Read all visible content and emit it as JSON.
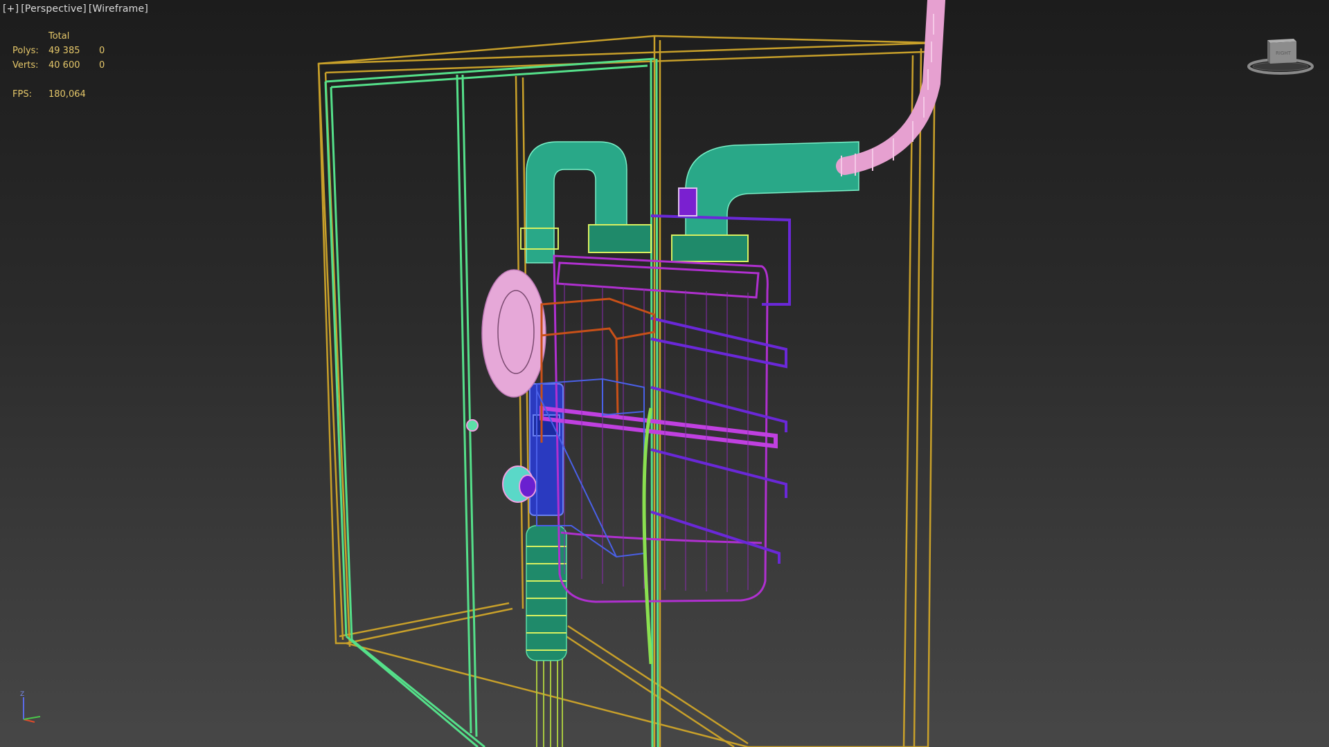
{
  "viewport": {
    "labels": [
      "[+]",
      "[Perspective]",
      "[Wireframe]"
    ]
  },
  "stats": {
    "header": "Total",
    "rows": [
      {
        "label": "Polys:",
        "total": "49 385",
        "selected": "0"
      },
      {
        "label": "Verts:",
        "total": "40 600",
        "selected": "0"
      }
    ],
    "fps_label": "FPS:",
    "fps_value": "180,064"
  },
  "viewcube": {
    "face_label": "RIGHT"
  },
  "axis": {
    "up_label": "Z"
  },
  "colors": {
    "background_top": "#1c1c1c",
    "background_bottom": "#474747",
    "cabinet_gold": "#c8a02a",
    "door_green": "#55e08a",
    "pipe_teal": "#2fb89a",
    "meter_magenta": "#b030d0",
    "accent_pink": "#e6a0d0",
    "bracket_blue": "#3a4ad8",
    "frame_orange": "#c85018",
    "stats_text": "#e6c86a"
  }
}
